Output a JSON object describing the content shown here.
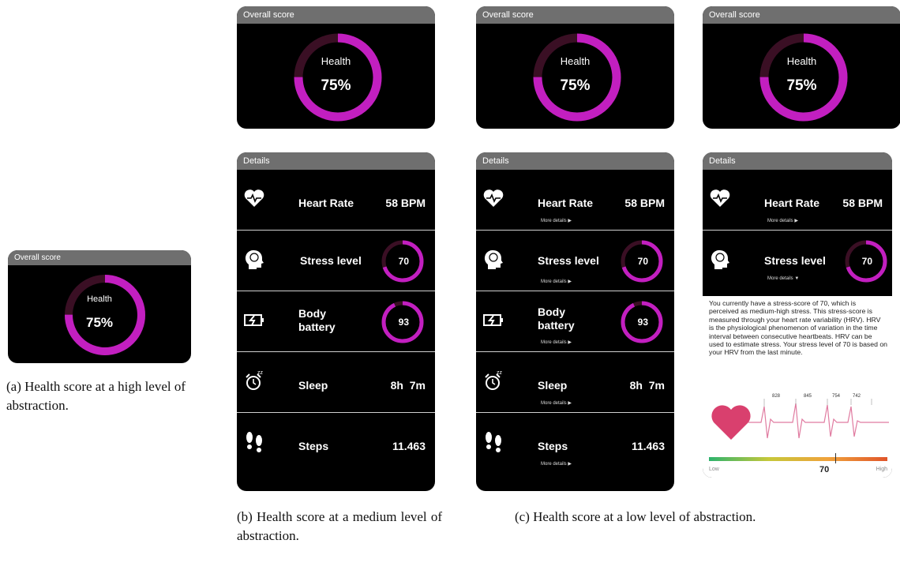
{
  "overall": {
    "header": "Overall score",
    "title": "Health",
    "value": "75%",
    "percent": 75
  },
  "details_header": "Details",
  "metrics": {
    "heart_rate": {
      "label": "Heart Rate",
      "value": "58 BPM"
    },
    "stress": {
      "label": "Stress level",
      "value": "70",
      "percent": 70
    },
    "body_battery": {
      "label_line1": "Body",
      "label_line2": "battery",
      "value": "93",
      "percent": 93
    },
    "sleep": {
      "label": "Sleep",
      "value": "8h  7m"
    },
    "steps": {
      "label": "Steps",
      "value": "11.463"
    }
  },
  "more_details": "More details",
  "explanation": {
    "text": "You currently have a stress-score of 70, which is perceived as medium-high stress. This stress-score is measured through your heart rate variability (HRV). HRV is the physiological phenomenon of variation in the time interval between consecutive heartbeats. HRV can be used to estimate stress. Your stress level of 70 is based on your HRV from the last minute.",
    "rr_intervals": [
      "828",
      "845",
      "754",
      "742"
    ],
    "scale_low": "Low",
    "scale_high": "High",
    "scale_value": "70"
  },
  "captions": {
    "a": "(a) Health score at a high level of abstraction.",
    "b": "(b) Health score at a medium level of abstraction.",
    "c": "(c) Health score at a low level of abstraction."
  },
  "colors": {
    "ring": "#c21fc0",
    "ring_track": "#3a0f24",
    "heart": "#d9406e",
    "ecg": "#e07ba0"
  }
}
